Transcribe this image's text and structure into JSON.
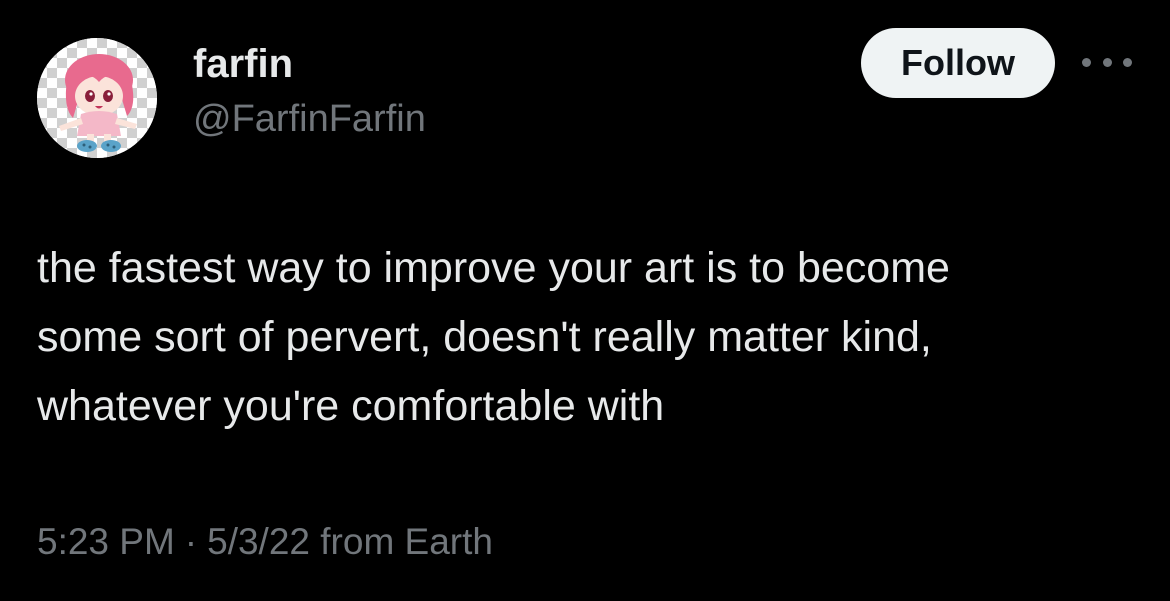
{
  "author": {
    "display_name": "farfin",
    "handle": "@FarfinFarfin",
    "avatar_icon": "anime-character-avatar-icon"
  },
  "header": {
    "follow_label": "Follow",
    "more_icon": "more-horizontal-icon"
  },
  "tweet": {
    "lines": [
      "the fastest way to improve your art is to become",
      "some sort of pervert, doesn't really matter kind,",
      "whatever you're comfortable with"
    ]
  },
  "meta": {
    "time": "5:23 PM",
    "separator": "·",
    "date_source": "5/3/22 from Earth"
  },
  "colors": {
    "background": "#000000",
    "primary_text": "#e7e9ea",
    "secondary_text": "#71767b",
    "follow_bg": "#eff3f4",
    "follow_text": "#0f1419"
  }
}
